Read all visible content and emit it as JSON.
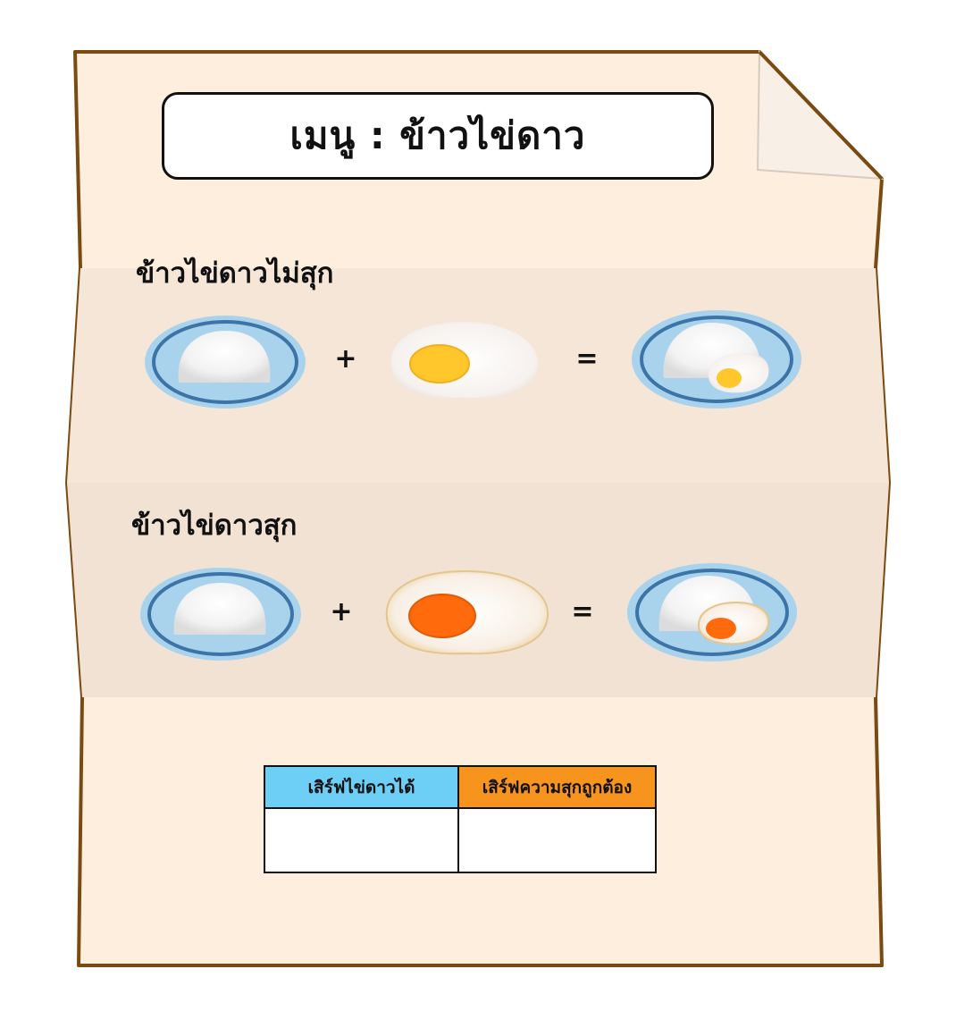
{
  "menu": {
    "title": "เมนู : ข้าวไข่ดาว"
  },
  "sections": [
    {
      "label": "ข้าวไข่ดาวไม่สุก",
      "plus": "+",
      "equals": "=",
      "ingredients": [
        "rice-plate-icon",
        "raw-fried-egg-icon"
      ],
      "result": "rice-with-raw-egg-icon"
    },
    {
      "label": "ข้าวไข่ดาวสุก",
      "plus": "+",
      "equals": "=",
      "ingredients": [
        "rice-plate-icon",
        "cooked-fried-egg-icon"
      ],
      "result": "rice-with-cooked-egg-icon"
    }
  ],
  "score_table": {
    "col1_header": "เสิร์ฟไข่ดาวได้",
    "col2_header": "เสิร์ฟความสุกถูกต้อง",
    "col1_value": "",
    "col2_value": "",
    "col1_color": "#6dcff6",
    "col2_color": "#f7941d"
  },
  "colors": {
    "paper": "#fdeedd",
    "paper_band": "#f3e4d6",
    "paper_border": "#7a4a12",
    "plate_outer": "#a9d3ec",
    "plate_rim": "#3d74a8",
    "yolk_raw": "#ffc72c",
    "yolk_cooked": "#ff6a0d"
  }
}
